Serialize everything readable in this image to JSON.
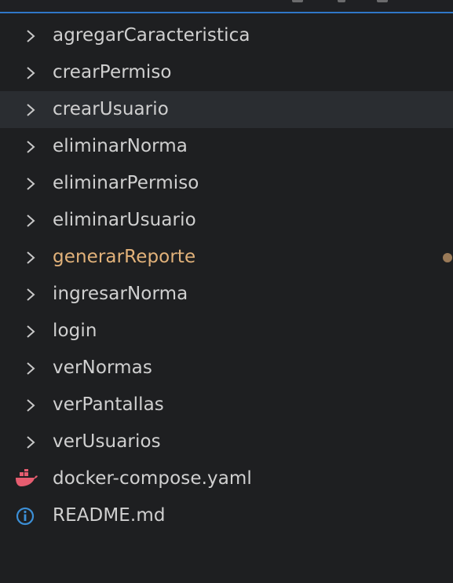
{
  "explorer": {
    "folders": [
      {
        "label": "agregarCaracteristica",
        "icon": "chevron-right-icon"
      },
      {
        "label": "crearPermiso",
        "icon": "chevron-right-icon"
      },
      {
        "label": "crearUsuario",
        "icon": "chevron-right-icon",
        "selected": true
      },
      {
        "label": "eliminarNorma",
        "icon": "chevron-right-icon"
      },
      {
        "label": "eliminarPermiso",
        "icon": "chevron-right-icon"
      },
      {
        "label": "eliminarUsuario",
        "icon": "chevron-right-icon"
      },
      {
        "label": "generarReporte",
        "icon": "chevron-right-icon",
        "modified": true,
        "modified_color": "#e2b27a"
      },
      {
        "label": "ingresarNorma",
        "icon": "chevron-right-icon"
      },
      {
        "label": "login",
        "icon": "chevron-right-icon"
      },
      {
        "label": "verNormas",
        "icon": "chevron-right-icon"
      },
      {
        "label": "verPantallas",
        "icon": "chevron-right-icon"
      },
      {
        "label": "verUsuarios",
        "icon": "chevron-right-icon"
      }
    ],
    "files": [
      {
        "label": "docker-compose.yaml",
        "icon": "docker-icon",
        "icon_color": "#e65d70"
      },
      {
        "label": "README.md",
        "icon": "info-icon",
        "icon_color": "#3c8fd6"
      }
    ]
  },
  "colors": {
    "background": "#1e1f21",
    "selected_row": "#2a2d31",
    "accent": "#2f77c8",
    "text": "#d0d0d0"
  }
}
